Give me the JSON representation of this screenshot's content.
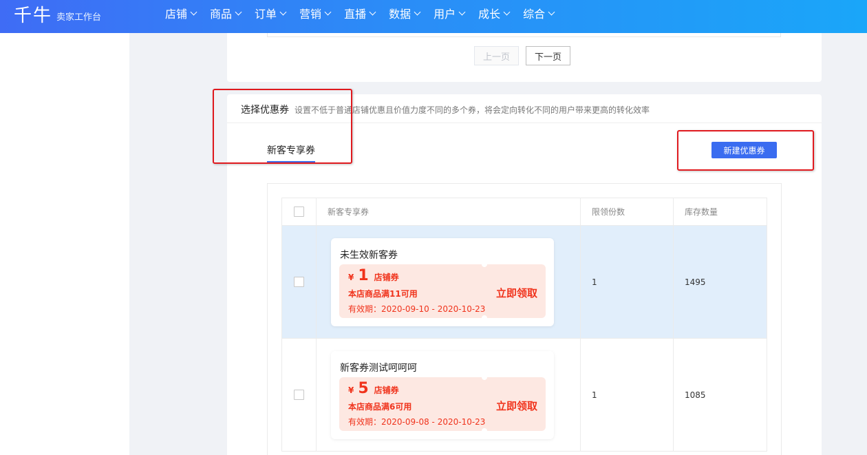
{
  "header": {
    "logo": "千牛",
    "subtitle": "卖家工作台",
    "nav": [
      {
        "label": "店铺"
      },
      {
        "label": "商品"
      },
      {
        "label": "订单"
      },
      {
        "label": "营销"
      },
      {
        "label": "直播"
      },
      {
        "label": "数据"
      },
      {
        "label": "用户"
      },
      {
        "label": "成长"
      },
      {
        "label": "综合"
      }
    ]
  },
  "pagination": {
    "prev": "上一页",
    "next": "下一页"
  },
  "section": {
    "title": "选择优惠券",
    "description": "设置不低于普通店铺优惠且价值力度不同的多个券，将会定向转化不同的用户带来更高的转化效率",
    "tab": "新客专享券",
    "new_button": "新建优惠券"
  },
  "table": {
    "columns": [
      "新客专享券",
      "限领份数",
      "库存数量"
    ],
    "rows": [
      {
        "name": "未生效新客券",
        "currency": "¥",
        "amount": "1",
        "unit": "店铺券",
        "condition": "本店商品满11可用",
        "validity": "有效期：2020-09-10 - 2020-10-23",
        "claim": "立即领取",
        "limit": "1",
        "stock": "1495",
        "highlighted": true
      },
      {
        "name": "新客券测试呵呵呵",
        "currency": "¥",
        "amount": "5",
        "unit": "店铺券",
        "condition": "本店商品满6可用",
        "validity": "有效期：2020-09-08 - 2020-10-23",
        "claim": "立即领取",
        "limit": "1",
        "stock": "1085",
        "highlighted": false
      }
    ]
  },
  "colors": {
    "brand": "#3a6cf0",
    "coupon_red": "#f0331c",
    "highlight_row": "#e1eefb",
    "annotation_red": "#e0191e"
  }
}
